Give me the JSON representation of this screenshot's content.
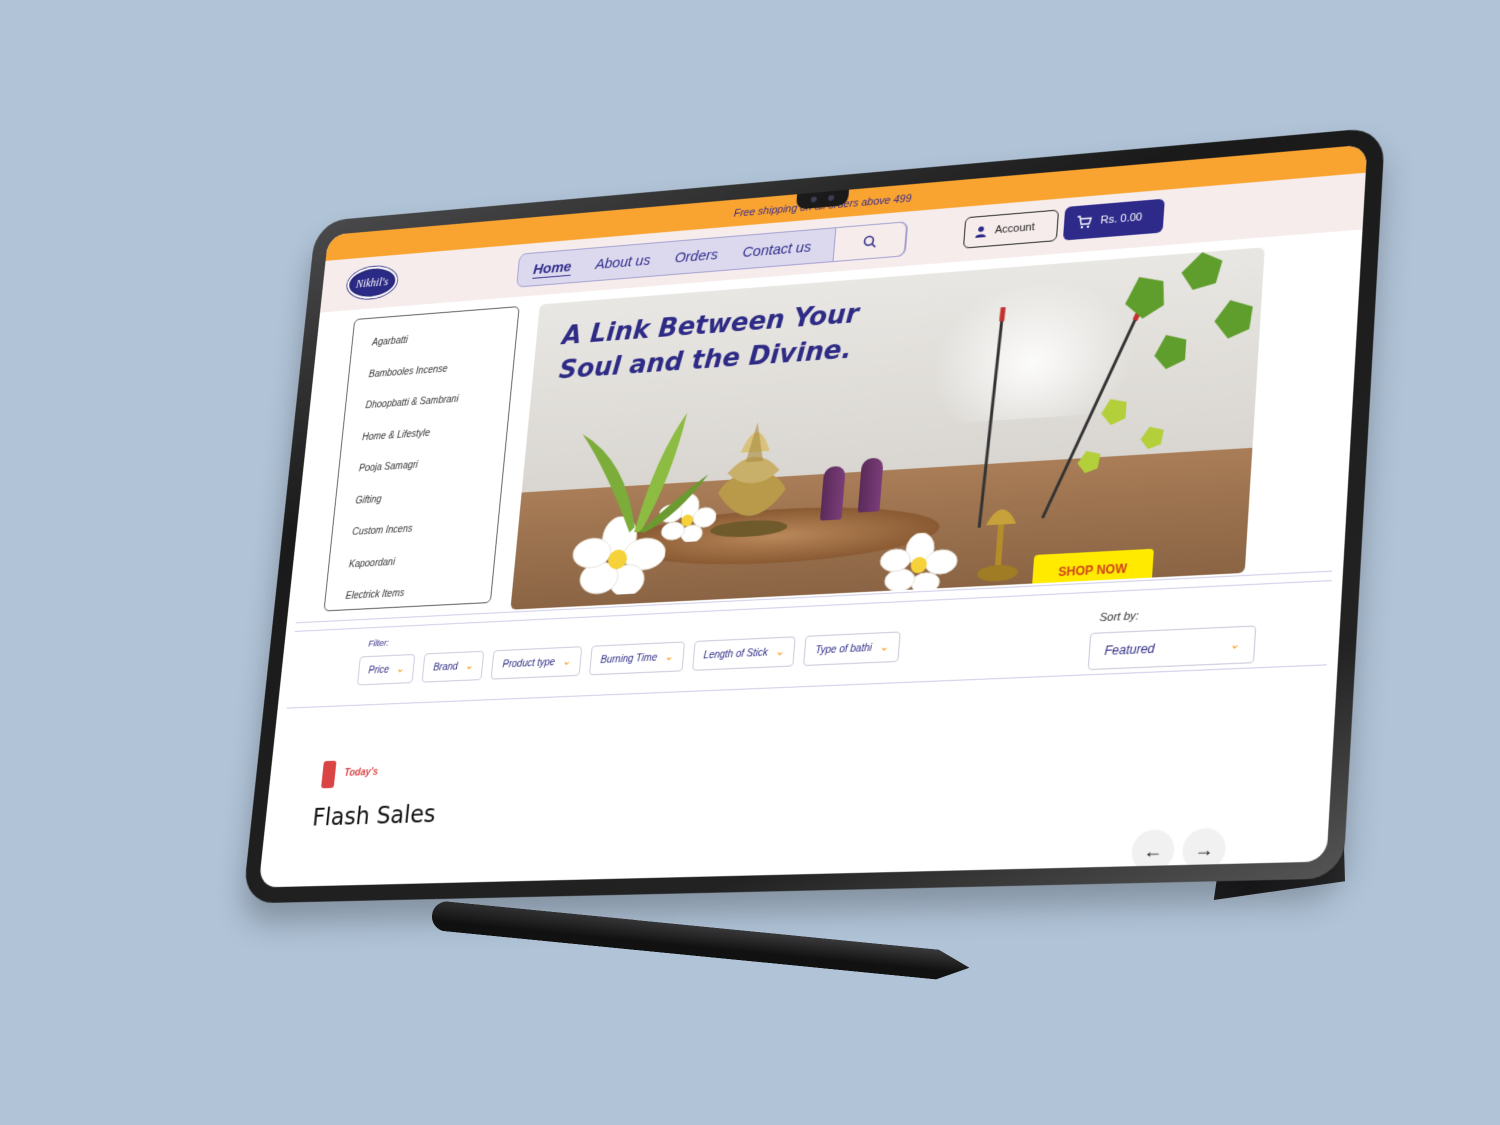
{
  "promo": {
    "text": "Free shipping on all orders above 499"
  },
  "header": {
    "logo_text": "Nikhil's",
    "nav": [
      {
        "label": "Home",
        "active": true
      },
      {
        "label": "About us"
      },
      {
        "label": "Orders"
      },
      {
        "label": "Contact us"
      }
    ],
    "account_label": "Account",
    "cart_label": "Rs. 0.00"
  },
  "categories": [
    "Agarbatti",
    "Bambooles Incense",
    "Dhoopbatti & Sambrani",
    "Home & Lifestyle",
    "Pooja Samagri",
    "Gifting",
    "Custom Incens",
    "Kapoordani",
    "Electrick Items"
  ],
  "hero": {
    "title_line1": "A Link Between Your",
    "title_line2": "Soul and the Divine.",
    "cta": "SHOP NOW"
  },
  "filter": {
    "label": "Filter:",
    "chips": [
      "Price",
      "Brand",
      "Product type",
      "Burning Time",
      "Length of Stick",
      "Type of bathi"
    ],
    "sort_label": "Sort by:",
    "sort_value": "Featured"
  },
  "flash": {
    "tag": "Today's",
    "title": "Flash Sales"
  },
  "colors": {
    "accent_orange": "#f9a431",
    "brand_blue": "#2d2a8a",
    "sale_red": "#db4444",
    "cta_yellow": "#ffea00"
  }
}
